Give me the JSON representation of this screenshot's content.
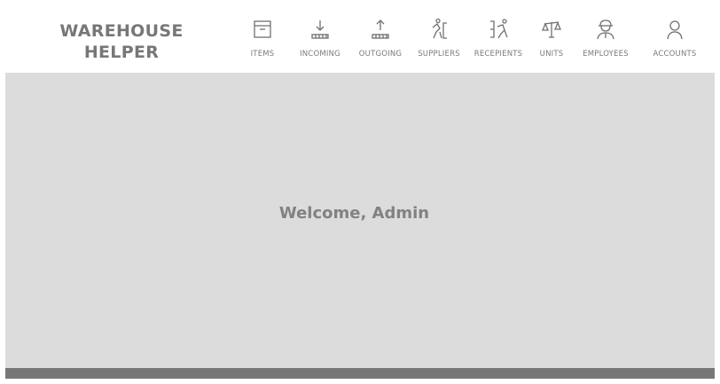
{
  "brand": {
    "line1": "WAREHOUSE",
    "line2": "HELPER"
  },
  "nav": [
    {
      "label": "ITEMS",
      "icon": "archive-box-icon"
    },
    {
      "label": "INCOMING",
      "icon": "download-tray-icon"
    },
    {
      "label": "OUTGOING",
      "icon": "upload-tray-icon"
    },
    {
      "label": "SUPPLIERS",
      "icon": "person-pushing-icon"
    },
    {
      "label": "RECEPIENTS",
      "icon": "person-receiving-icon"
    },
    {
      "label": "UNITS",
      "icon": "scale-icon"
    },
    {
      "label": "EMPLOYEES",
      "icon": "worker-helmet-icon"
    },
    {
      "label": "ACCOUNTS",
      "icon": "user-icon"
    }
  ],
  "main": {
    "welcome": "Welcome, Admin"
  },
  "colors": {
    "panel": "#dcdcdc",
    "footer": "#777777",
    "text": "#7a7a7a"
  }
}
